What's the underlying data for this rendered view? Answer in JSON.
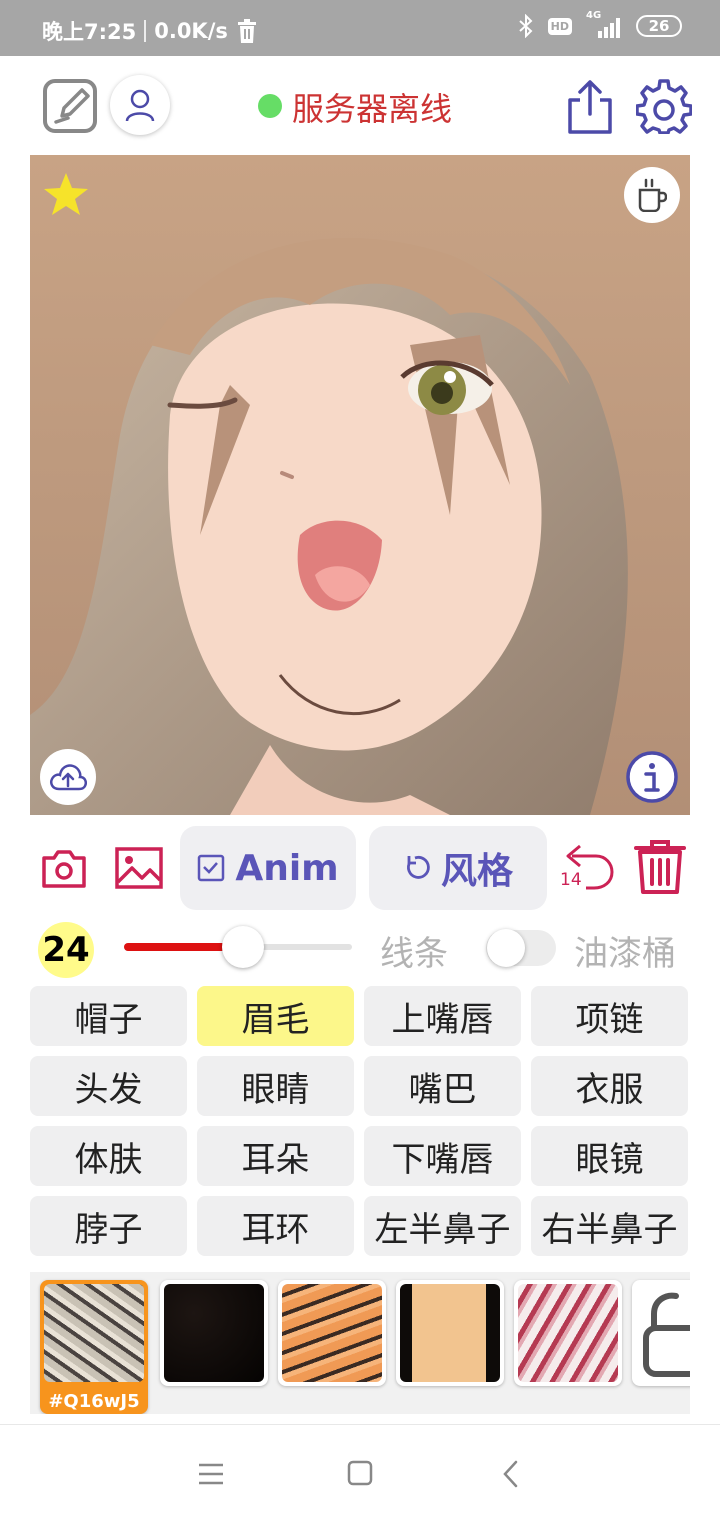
{
  "status_bar": {
    "time": "晚上7:25",
    "net_speed": "0.0K/s",
    "hd_label": "HD",
    "signal_label": "4G",
    "battery": "26",
    "icons": [
      "trash-icon",
      "bluetooth-icon",
      "hd-icon",
      "signal-icon",
      "battery-icon"
    ]
  },
  "header": {
    "server_status": "服务器离线",
    "status_color": "#66dd66",
    "status_text_color": "#cc3333",
    "icons": [
      "edit-icon",
      "user-icon",
      "share-icon",
      "settings-icon"
    ]
  },
  "portrait": {
    "icons": [
      "star-icon",
      "coffee-icon",
      "cloud-upload-icon",
      "info-icon"
    ]
  },
  "tools": {
    "anim_label": "Anim",
    "style_label": "风格",
    "undo_count": "14",
    "icons": [
      "camera-icon",
      "image-icon",
      "checkbox-icon",
      "refresh-icon",
      "undo-icon",
      "trash-icon"
    ]
  },
  "brush": {
    "size": "24",
    "slider_fraction": 0.52,
    "line_label": "线条",
    "bucket_label": "油漆桶",
    "bucket_enabled": false
  },
  "parts": [
    "帽子",
    "眉毛",
    "上嘴唇",
    "项链",
    "头发",
    "眼睛",
    "嘴巴",
    "衣服",
    "体肤",
    "耳朵",
    "下嘴唇",
    "眼镜",
    "脖子",
    "耳环",
    "左半鼻子",
    "右半鼻子"
  ],
  "selected_part": "眉毛",
  "textures": {
    "selected_code": "#Q16wJ5",
    "accent": "#f7941d",
    "icons": [
      "lock-icon"
    ]
  },
  "navbar": {
    "icons": [
      "menu-icon",
      "home-icon",
      "back-icon"
    ]
  }
}
